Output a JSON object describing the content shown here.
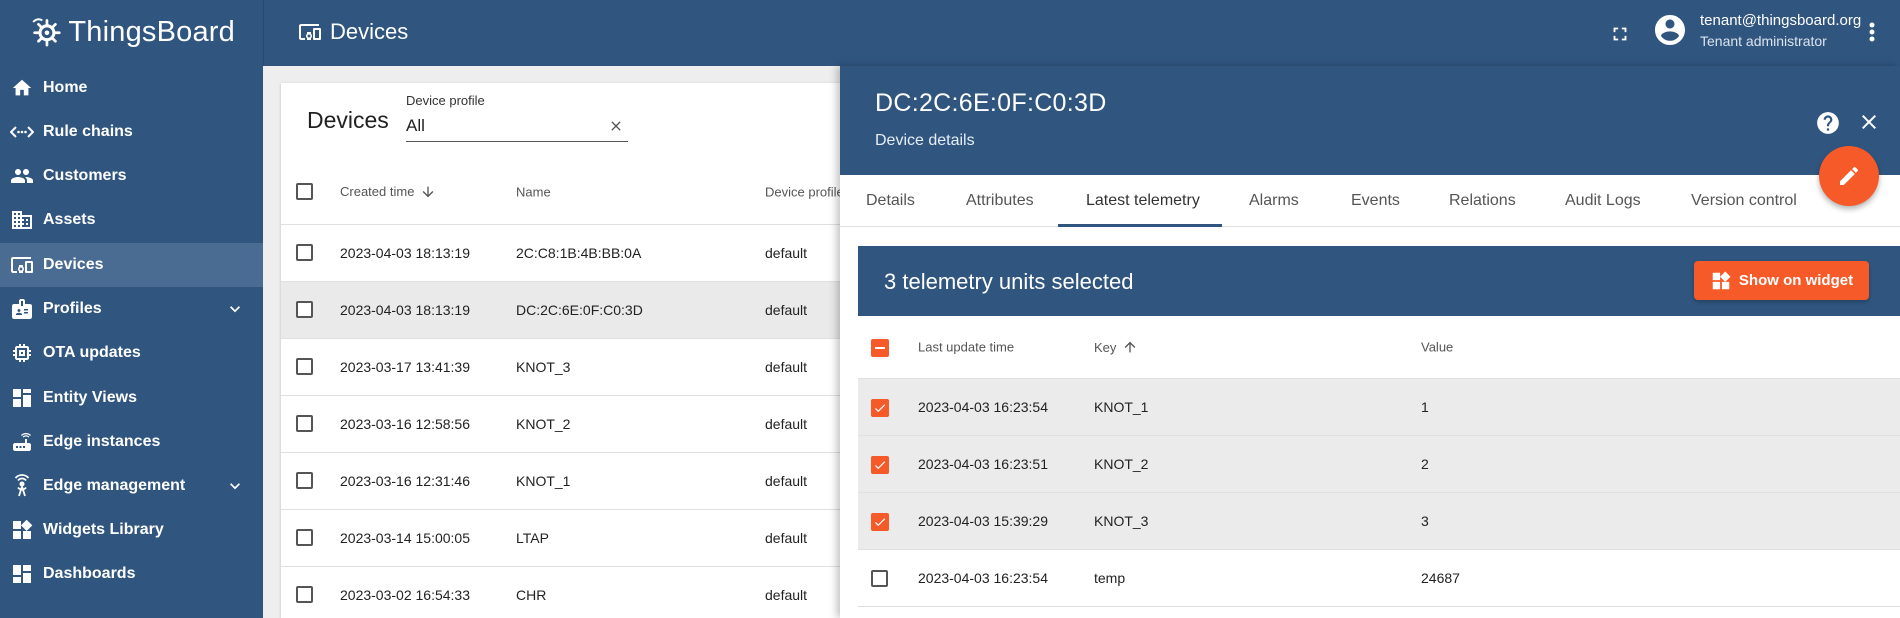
{
  "app": {
    "name": "ThingsBoard",
    "page_title": "Devices"
  },
  "user": {
    "email": "tenant@thingsboard.org",
    "role": "Tenant administrator"
  },
  "sidebar": {
    "items": [
      {
        "label": "Home",
        "icon": "home-icon"
      },
      {
        "label": "Rule chains",
        "icon": "rule-chains-icon"
      },
      {
        "label": "Customers",
        "icon": "customers-icon"
      },
      {
        "label": "Assets",
        "icon": "assets-icon"
      },
      {
        "label": "Devices",
        "icon": "devices-icon",
        "active": true
      },
      {
        "label": "Profiles",
        "icon": "profiles-icon",
        "expandable": true
      },
      {
        "label": "OTA updates",
        "icon": "ota-icon"
      },
      {
        "label": "Entity Views",
        "icon": "entity-views-icon"
      },
      {
        "label": "Edge instances",
        "icon": "edge-instances-icon"
      },
      {
        "label": "Edge management",
        "icon": "edge-management-icon",
        "expandable": true
      },
      {
        "label": "Widgets Library",
        "icon": "widgets-icon"
      },
      {
        "label": "Dashboards",
        "icon": "dashboards-icon"
      }
    ]
  },
  "devices": {
    "title": "Devices",
    "filter_label": "Device profile",
    "filter_value": "All",
    "columns": [
      "Created time",
      "Name",
      "Device profile"
    ],
    "rows": [
      {
        "created": "2023-04-03 18:13:19",
        "name": "2C:C8:1B:4B:BB:0A",
        "profile": "default"
      },
      {
        "created": "2023-04-03 18:13:19",
        "name": "DC:2C:6E:0F:C0:3D",
        "profile": "default",
        "selected": true
      },
      {
        "created": "2023-03-17 13:41:39",
        "name": "KNOT_3",
        "profile": "default"
      },
      {
        "created": "2023-03-16 12:58:56",
        "name": "KNOT_2",
        "profile": "default"
      },
      {
        "created": "2023-03-16 12:31:46",
        "name": "KNOT_1",
        "profile": "default"
      },
      {
        "created": "2023-03-14 15:00:05",
        "name": "LTAP",
        "profile": "default"
      },
      {
        "created": "2023-03-02 16:54:33",
        "name": "CHR",
        "profile": "default"
      }
    ]
  },
  "details": {
    "device_name": "DC:2C:6E:0F:C0:3D",
    "subtitle": "Device details",
    "tabs": [
      "Details",
      "Attributes",
      "Latest telemetry",
      "Alarms",
      "Events",
      "Relations",
      "Audit Logs",
      "Version control"
    ],
    "active_tab": "Latest telemetry"
  },
  "telemetry": {
    "selection_title": "3 telemetry units selected",
    "show_button": "Show on widget",
    "columns": [
      "Last update time",
      "Key",
      "Value"
    ],
    "rows": [
      {
        "time": "2023-04-03 16:23:54",
        "key": "KNOT_1",
        "value": "1",
        "checked": true
      },
      {
        "time": "2023-04-03 16:23:51",
        "key": "KNOT_2",
        "value": "2",
        "checked": true
      },
      {
        "time": "2023-04-03 15:39:29",
        "key": "KNOT_3",
        "value": "3",
        "checked": true
      },
      {
        "time": "2023-04-03 16:23:54",
        "key": "temp",
        "value": "24687",
        "checked": false
      }
    ]
  },
  "colors": {
    "primary": "#305680",
    "accent": "#f75a29",
    "sidebar_active": "#4a6c92"
  }
}
